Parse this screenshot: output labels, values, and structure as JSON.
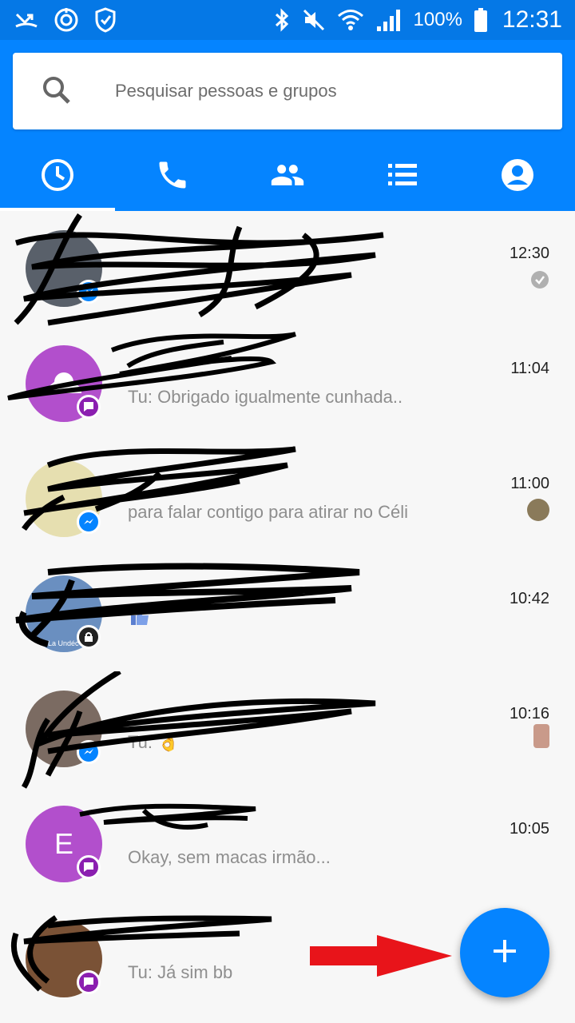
{
  "status_bar": {
    "battery": "100%",
    "time": "12:31",
    "icons": [
      "missed-call-icon",
      "sync-icon",
      "shield-check-icon",
      "bluetooth-icon",
      "mute-icon",
      "wifi-icon",
      "signal-icon",
      "battery-icon"
    ]
  },
  "search": {
    "placeholder": "Pesquisar pessoas e grupos"
  },
  "tabs": [
    {
      "name": "recent",
      "icon": "clock-icon",
      "active": true
    },
    {
      "name": "calls",
      "icon": "phone-icon",
      "active": false
    },
    {
      "name": "groups",
      "icon": "people-icon",
      "active": false
    },
    {
      "name": "list",
      "icon": "list-icon",
      "active": false
    },
    {
      "name": "profile",
      "icon": "account-icon",
      "active": false
    }
  ],
  "conversations": [
    {
      "time": "12:30",
      "snippet": "",
      "badge": "messenger-badge-icon",
      "status": "seen-check-icon",
      "avatar_color": "#59606a"
    },
    {
      "time": "11:04",
      "snippet": "Tu: Obrigado igualmente cunhada..",
      "badge": "sms-badge-icon",
      "avatar_color": "#b24fcc"
    },
    {
      "time": "11:00",
      "snippet": "para falar contigo para atirar no Céli",
      "badge": "messenger-badge-icon",
      "status": "photo-avatar-icon",
      "avatar_color": "#e6dfb0"
    },
    {
      "time": "10:42",
      "snippet": "",
      "badge": "lock-badge-icon",
      "status": "",
      "avatar_color": "#6a8fc0",
      "avatar_text": "La Undéc"
    },
    {
      "time": "10:16",
      "snippet": "Tu: 👌",
      "badge": "messenger-badge-icon",
      "status": "photo-avatar-icon",
      "avatar_color": "#7b6b62"
    },
    {
      "time": "10:05",
      "snippet": "Okay, sem macas irmão...",
      "badge": "sms-badge-icon",
      "avatar_color": "#b24fcc",
      "avatar_letter": "E"
    },
    {
      "time": "",
      "snippet": "Tu: Já sim bb",
      "badge": "sms-badge-icon",
      "avatar_color": "#7a5236"
    }
  ],
  "fab": {
    "icon": "plus-icon"
  },
  "colors": {
    "primary": "#0584ff",
    "status_bar": "#0578e6",
    "annotation_arrow": "#e8141a"
  }
}
